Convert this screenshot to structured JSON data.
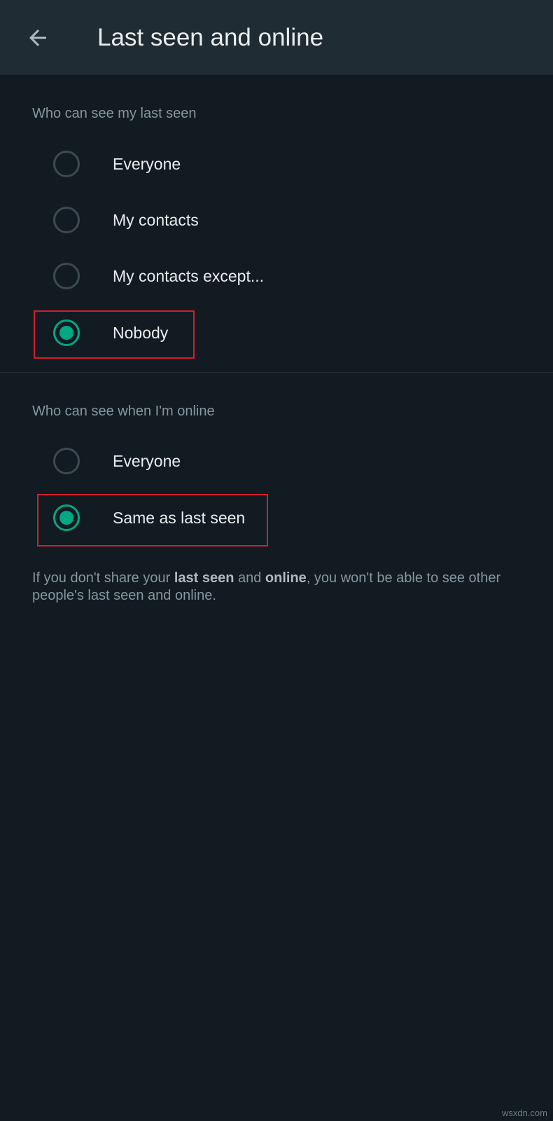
{
  "header": {
    "title": "Last seen and online",
    "back_icon": "arrow-left-icon"
  },
  "last_seen": {
    "header": "Who can see my last seen",
    "options": [
      {
        "label": "Everyone",
        "selected": false
      },
      {
        "label": "My contacts",
        "selected": false
      },
      {
        "label": "My contacts except...",
        "selected": false
      },
      {
        "label": "Nobody",
        "selected": true
      }
    ]
  },
  "online": {
    "header": "Who can see when I'm online",
    "options": [
      {
        "label": "Everyone",
        "selected": false
      },
      {
        "label": "Same as last seen",
        "selected": true
      }
    ]
  },
  "footnote": {
    "part1": "If you don't share your ",
    "bold1": "last seen",
    "part2": " and ",
    "bold2": "online",
    "part3": ", you won't be able to see other people's last seen and online."
  },
  "watermark": "wsxdn.com",
  "colors": {
    "background": "#121b22",
    "app_bar": "#202c33",
    "accent": "#00a884",
    "highlight_box": "#d11f2a"
  }
}
